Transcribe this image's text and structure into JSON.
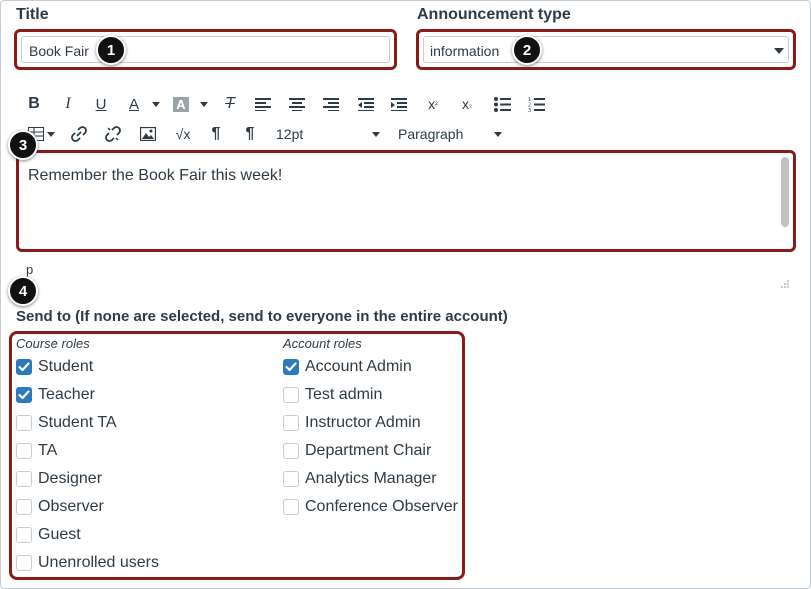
{
  "title_field": {
    "label": "Title",
    "value": "Book Fair",
    "callout": "1"
  },
  "type_field": {
    "label": "Announcement type",
    "value": "information",
    "callout": "2"
  },
  "toolbar": {
    "font_size": "12pt",
    "block_format": "Paragraph"
  },
  "editor": {
    "content": "Remember the Book Fair this week!",
    "callout": "3",
    "path": "p"
  },
  "send_to": {
    "heading": "Send to (If none are selected, send to everyone in the entire account)",
    "callout": "4",
    "course_roles": {
      "heading": "Course roles",
      "items": [
        {
          "label": "Student",
          "checked": true
        },
        {
          "label": "Teacher",
          "checked": true
        },
        {
          "label": "Student TA",
          "checked": false
        },
        {
          "label": "TA",
          "checked": false
        },
        {
          "label": "Designer",
          "checked": false
        },
        {
          "label": "Observer",
          "checked": false
        },
        {
          "label": "Guest",
          "checked": false
        },
        {
          "label": "Unenrolled users",
          "checked": false
        }
      ]
    },
    "account_roles": {
      "heading": "Account roles",
      "items": [
        {
          "label": "Account Admin",
          "checked": true
        },
        {
          "label": "Test admin",
          "checked": false
        },
        {
          "label": "Instructor Admin",
          "checked": false
        },
        {
          "label": "Department Chair",
          "checked": false
        },
        {
          "label": "Analytics Manager",
          "checked": false
        },
        {
          "label": "Conference Observer",
          "checked": false
        }
      ]
    }
  },
  "colors": {
    "highlight": "#8b1a1a",
    "check": "#2b7abc",
    "text": "#2d3b45"
  }
}
